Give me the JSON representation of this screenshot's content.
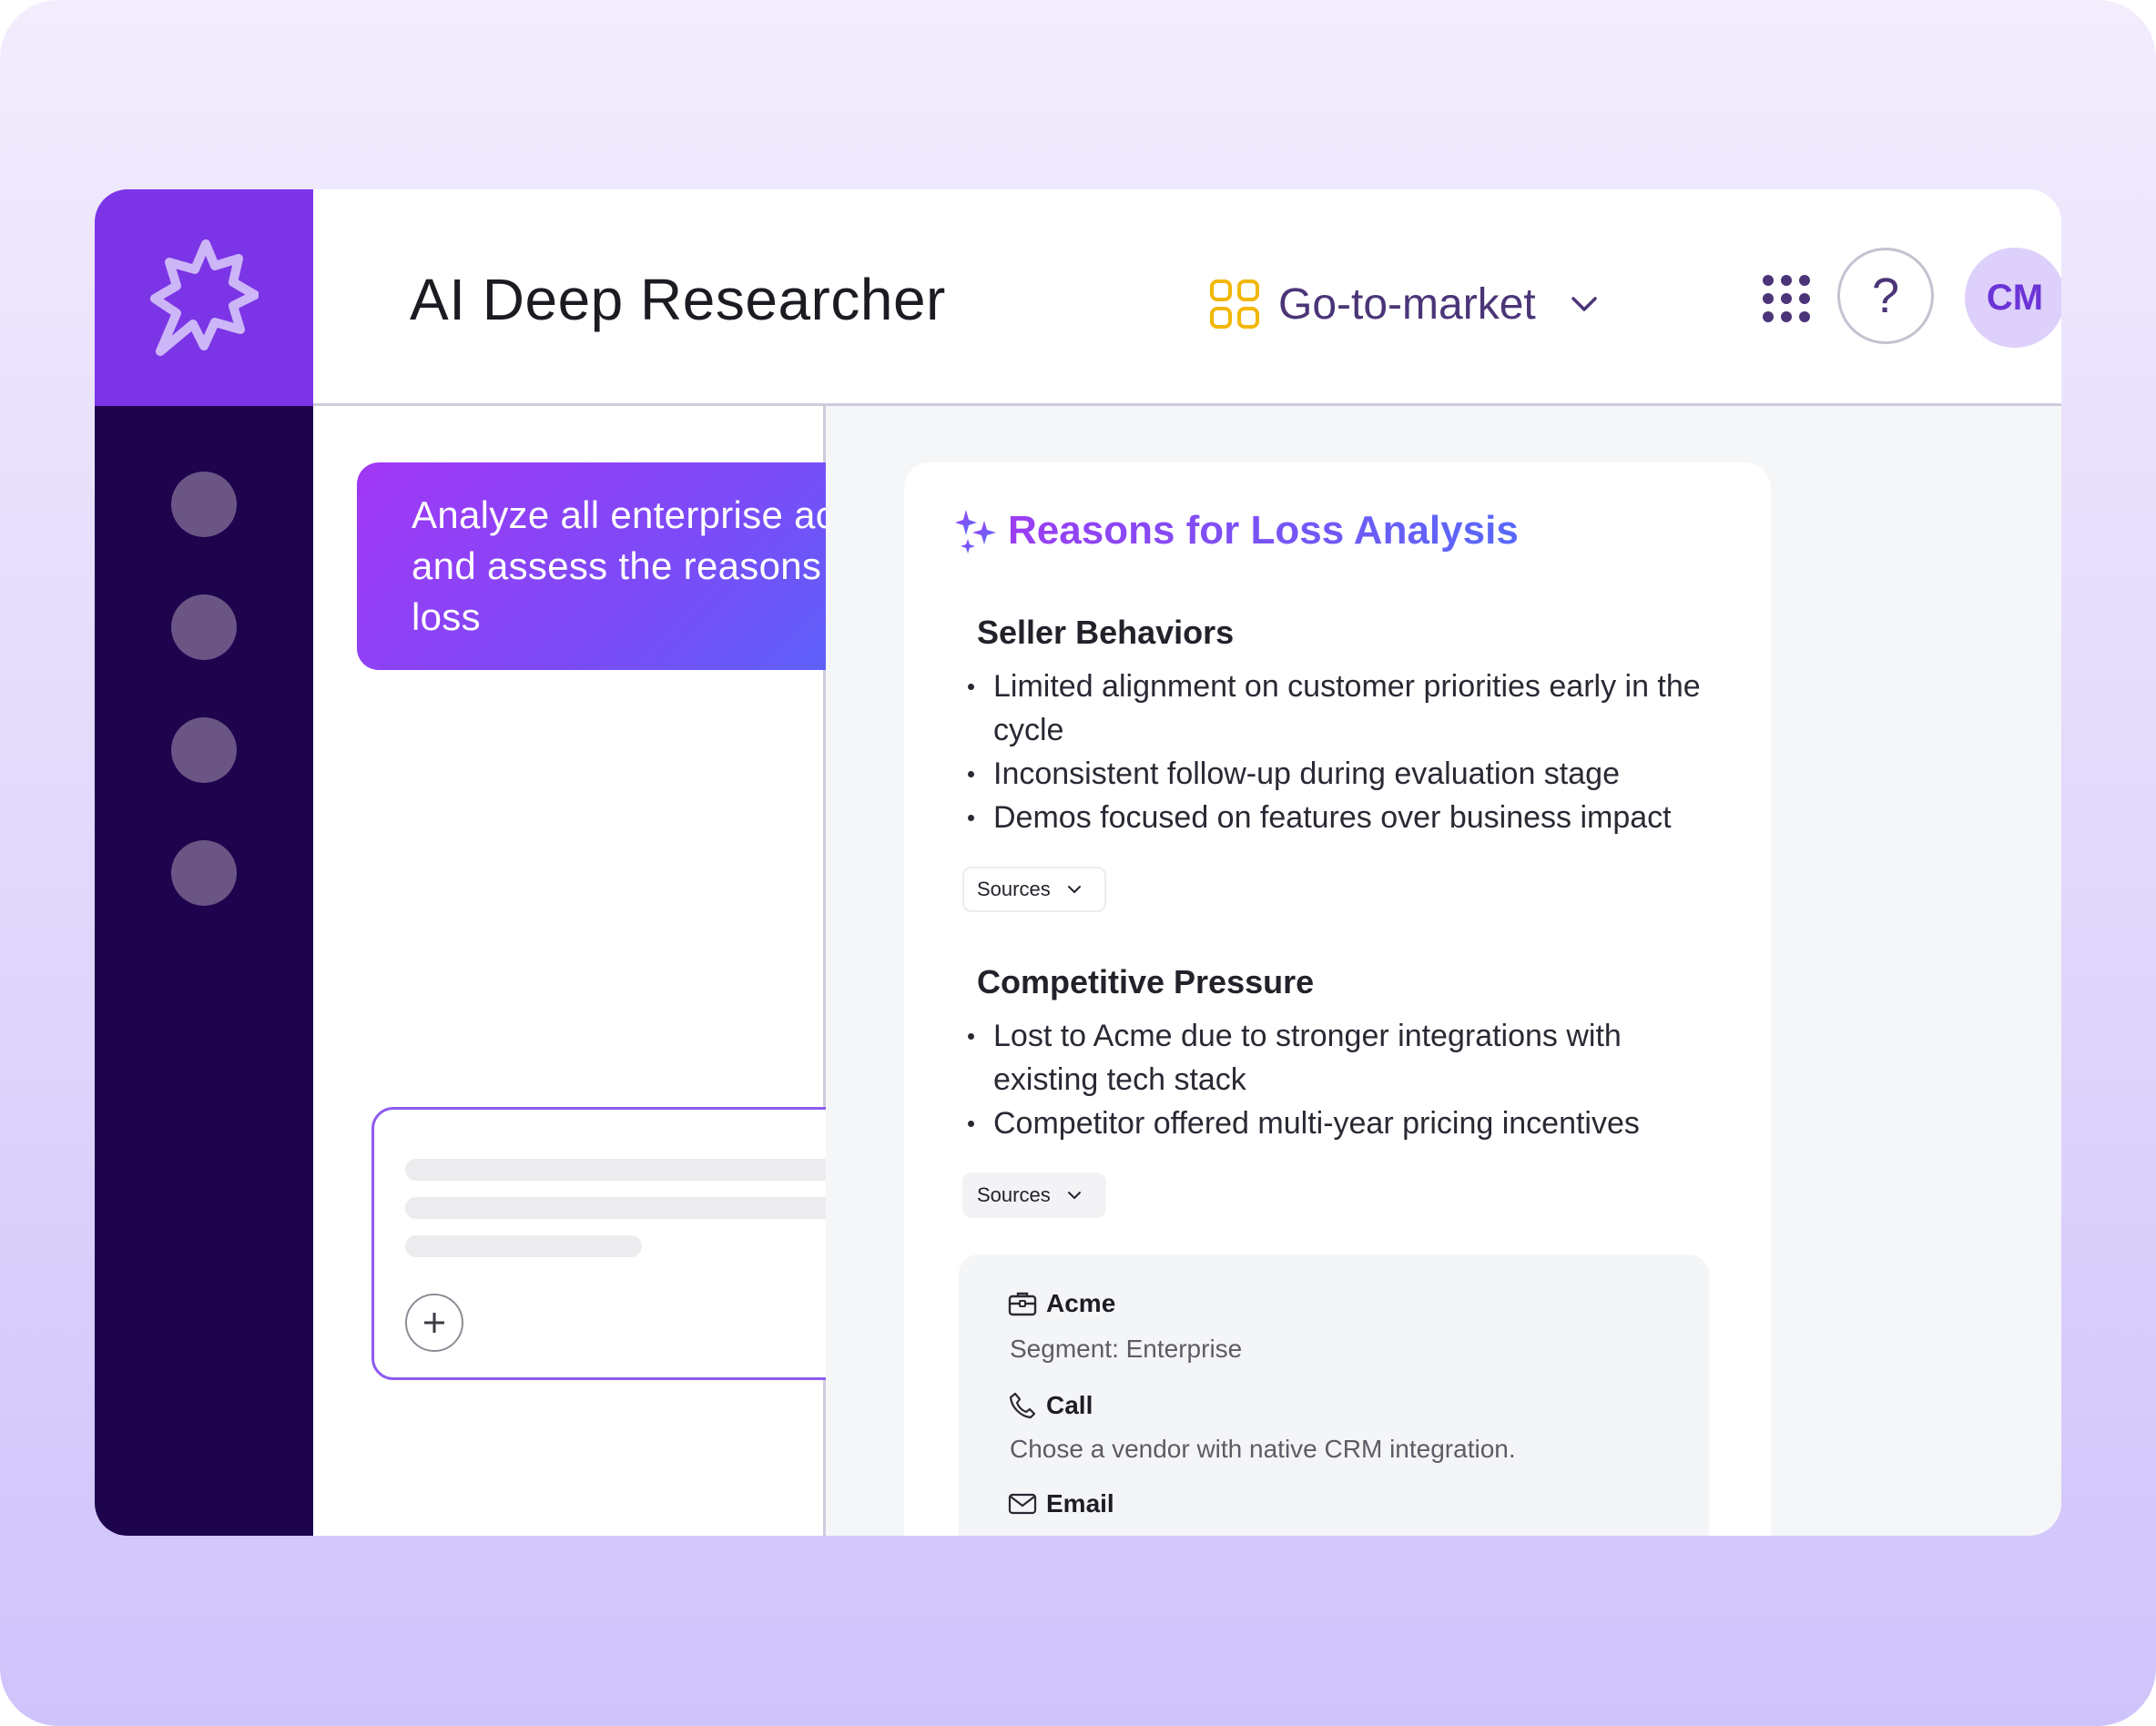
{
  "app": {
    "title": "AI Deep Researcher",
    "workspace": {
      "label": "Go-to-market",
      "icon": "grid-four-squares-icon",
      "accent": "#f2b705"
    },
    "help_label": "?",
    "avatar_initials": "CM"
  },
  "rail": {
    "items": [
      "nav-item-1",
      "nav-item-2",
      "nav-item-3",
      "nav-item-4"
    ]
  },
  "chat": {
    "prompt": "Analyze all enterprise accounts and assess the reasons for loss"
  },
  "report": {
    "title": "Reasons for Loss Analysis",
    "sections": [
      {
        "heading": "Seller Behaviors",
        "bullets": [
          "Limited alignment on customer priorities early in the cycle",
          "Inconsistent follow-up during evaluation stage",
          "Demos focused on features over business impact"
        ],
        "sources_label": "Sources"
      },
      {
        "heading": "Competitive Pressure",
        "bullets": [
          "Lost to Acme due to stronger integrations with existing tech stack",
          "Competitor offered multi-year pricing incentives"
        ],
        "sources_label": "Sources"
      }
    ],
    "details": {
      "account": {
        "label": "Acme",
        "text": "Segment: Enterprise",
        "icon": "briefcase-icon"
      },
      "call": {
        "label": "Call",
        "text": "Chose a vendor with native CRM integration.",
        "icon": "phone-icon"
      },
      "email": {
        "label": "Email",
        "icon": "mail-icon"
      }
    }
  },
  "colors": {
    "brand": "#7b35e6",
    "rail": "#1e034d",
    "gradient_start": "#a237f5",
    "gradient_end": "#4970fb"
  }
}
